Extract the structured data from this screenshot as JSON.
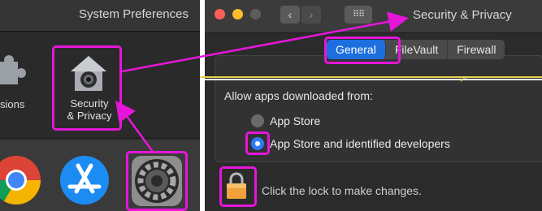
{
  "left_window": {
    "title": "System Preferences",
    "partial_pane_label": "sions",
    "security_pane": {
      "label_line1": "Security",
      "label_line2": "& Privacy"
    },
    "dock_icons": [
      "chrome-icon",
      "app-store-icon",
      "system-preferences-icon"
    ]
  },
  "right_window": {
    "title": "Security & Privacy",
    "grid_button": "⠿⠿",
    "tabs": [
      {
        "label": "General",
        "active": true
      },
      {
        "label": "FileVault",
        "active": false
      },
      {
        "label": "Firewall",
        "active": false
      }
    ],
    "allow_apps_label": "Allow apps downloaded from:",
    "options": [
      {
        "label": "App Store",
        "selected": false
      },
      {
        "label": "App Store and identified developers",
        "selected": true
      }
    ],
    "lock_text": "Click the lock to make changes."
  },
  "annotation_color": "#e616d9"
}
